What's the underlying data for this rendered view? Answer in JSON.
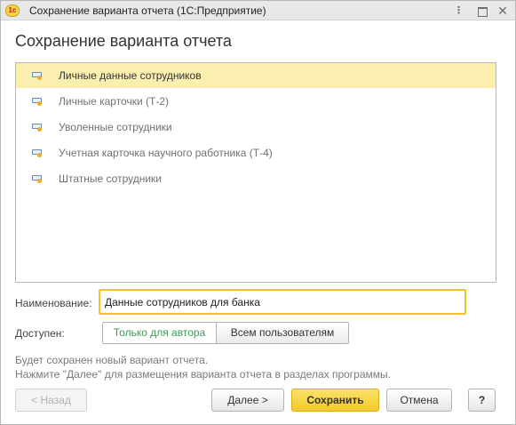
{
  "window": {
    "title": "Сохранение варианта отчета  (1С:Предприятие)",
    "app_icon_text": "1с",
    "more_glyph": "⋮",
    "close_glyph": "✕"
  },
  "form": {
    "heading": "Сохранение варианта отчета"
  },
  "variants": {
    "items": [
      {
        "label": "Личные данные сотрудников",
        "selected": true,
        "icon": "report-variant-icon"
      },
      {
        "label": "Личные карточки (Т-2)",
        "selected": false,
        "icon": "report-variant-icon"
      },
      {
        "label": "Уволенные сотрудники",
        "selected": false,
        "icon": "report-variant-icon"
      },
      {
        "label": "Учетная карточка научного работника (Т-4)",
        "selected": false,
        "icon": "report-variant-icon"
      },
      {
        "label": "Штатные сотрудники",
        "selected": false,
        "icon": "report-variant-icon"
      }
    ]
  },
  "name_field": {
    "label": "Наименование:",
    "value": "Данные сотрудников для банка"
  },
  "availability": {
    "label": "Доступен:",
    "options": [
      "Только для автора",
      "Всем пользователям"
    ],
    "selected": "Только для автора"
  },
  "info": {
    "line1": "Будет сохранен новый вариант отчета.",
    "line2": "Нажмите \"Далее\" для размещения варианта отчета в разделах программы."
  },
  "buttons": {
    "back": "< Назад",
    "next": "Далее >",
    "save": "Сохранить",
    "cancel": "Отмена",
    "help": "?"
  },
  "colors": {
    "selected_row": "#fbefb0",
    "input_focus_border": "#f2c12e",
    "primary_button": "#f3ca2b",
    "author_option_text": "#3d9a55"
  }
}
